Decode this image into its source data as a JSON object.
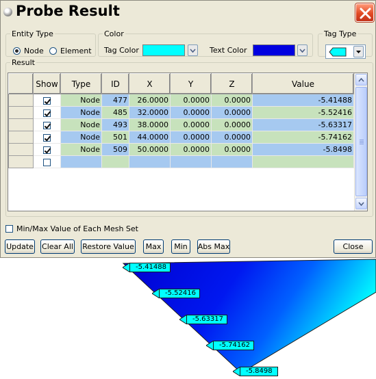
{
  "window": {
    "title": "Probe Result"
  },
  "entity_type": {
    "legend": "Entity Type",
    "options": [
      {
        "label": "Node",
        "selected": true
      },
      {
        "label": "Element",
        "selected": false
      }
    ]
  },
  "color": {
    "legend": "Color",
    "tag_color_label": "Tag Color",
    "tag_color": "#00ffff",
    "text_color_label": "Text Color",
    "text_color": "#0000e0"
  },
  "tag_type": {
    "legend": "Tag Type",
    "selected_icon": "arrow-tag-icon"
  },
  "result": {
    "legend": "Result",
    "columns": [
      "Show",
      "Type",
      "ID",
      "X",
      "Y",
      "Z",
      "Value"
    ],
    "rows": [
      {
        "show": true,
        "type": "Node",
        "id": "477",
        "x": "26.0000",
        "y": "0.0000",
        "z": "0.0000",
        "value": "-5.41488"
      },
      {
        "show": true,
        "type": "Node",
        "id": "485",
        "x": "32.0000",
        "y": "0.0000",
        "z": "0.0000",
        "value": "-5.52416"
      },
      {
        "show": true,
        "type": "Node",
        "id": "493",
        "x": "38.0000",
        "y": "0.0000",
        "z": "0.0000",
        "value": "-5.63317"
      },
      {
        "show": true,
        "type": "Node",
        "id": "501",
        "x": "44.0000",
        "y": "0.0000",
        "z": "0.0000",
        "value": "-5.74162"
      },
      {
        "show": true,
        "type": "Node",
        "id": "509",
        "x": "50.0000",
        "y": "0.0000",
        "z": "0.0000",
        "value": "-5.8498"
      },
      {
        "show": false,
        "type": "",
        "id": "",
        "x": "",
        "y": "",
        "z": "",
        "value": ""
      }
    ]
  },
  "minmax_checkbox": {
    "label": "Min/Max Value of Each Mesh Set",
    "checked": false
  },
  "buttons": {
    "update": "Update",
    "clear_all": "Clear All",
    "restore_value": "Restore Value",
    "max": "Max",
    "min": "Min",
    "abs_max": "Abs Max",
    "close": "Close"
  },
  "viewport_tags": [
    "-5.41488",
    "-5.52416",
    "-5.63317",
    "-5.74162",
    "-5.8498"
  ]
}
